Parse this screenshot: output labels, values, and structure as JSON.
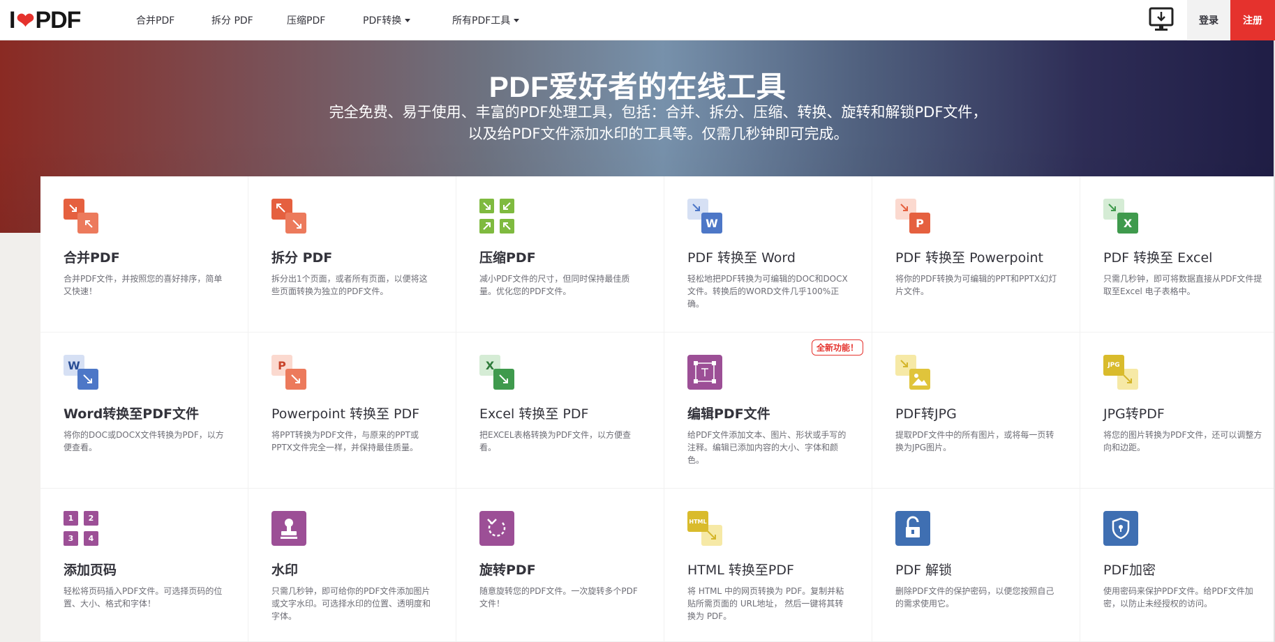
{
  "header": {
    "logo_left": "I",
    "logo_right": "PDF",
    "nav": [
      {
        "label": "合并PDF",
        "dropdown": false
      },
      {
        "label": "拆分 PDF",
        "dropdown": false
      },
      {
        "label": "压缩PDF",
        "dropdown": false
      },
      {
        "label": "PDF转换",
        "dropdown": true
      },
      {
        "label": "所有PDF工具",
        "dropdown": true
      }
    ],
    "login": "登录",
    "signup": "注册"
  },
  "hero": {
    "title": "PDF爱好者的在线工具",
    "subtitle": "完全免费、易于使用、丰富的PDF处理工具，包括：合并、拆分、压缩、转换、旋转和解锁PDF文件，以及给PDF文件添加水印的工具等。仅需几秒钟即可完成。"
  },
  "tools": [
    {
      "title": "合并PDF",
      "desc": "合并PDF文件，并按照您的喜好排序，简单又快速！",
      "icon": "merge-icon"
    },
    {
      "title": "拆分 PDF",
      "desc": "拆分出1个页面，或者所有页面，以便将这些页面转换为独立的PDF文件。",
      "icon": "split-icon"
    },
    {
      "title": "压缩PDF",
      "desc": "减小PDF文件的尺寸，但同时保持最佳质量。优化您的PDF文件。",
      "icon": "compress-icon"
    },
    {
      "title": "PDF 转换至 Word",
      "desc": "轻松地把PDF转换为可编辑的DOC和DOCX文件。转换后的WORD文件几乎100%正确。",
      "icon": "pdf-to-word-icon"
    },
    {
      "title": "PDF 转换至 Powerpoint",
      "desc": "将你的PDF转换为可编辑的PPT和PPTX幻灯片文件。",
      "icon": "pdf-to-powerpoint-icon"
    },
    {
      "title": "PDF 转换至 Excel",
      "desc": "只需几秒钟，即可将数据直接从PDF文件提取至Excel 电子表格中。",
      "icon": "pdf-to-excel-icon"
    },
    {
      "title": "Word转换至PDF文件",
      "desc": "将你的DOC或DOCX文件转换为PDF，以方便查看。",
      "icon": "word-to-pdf-icon"
    },
    {
      "title": "Powerpoint 转换至 PDF",
      "desc": "将PPT转换为PDF文件，与原来的PPT或PPTX文件完全一样，并保持最佳质量。",
      "icon": "powerpoint-to-pdf-icon"
    },
    {
      "title": "Excel 转换至 PDF",
      "desc": "把EXCEL表格转换为PDF文件，以方便查看。",
      "icon": "excel-to-pdf-icon"
    },
    {
      "title": "编辑PDF文件",
      "desc": "给PDF文件添加文本、图片、形状或手写的注释。编辑已添加内容的大小、字体和颜色。",
      "icon": "edit-pdf-icon",
      "badge": "全新功能！"
    },
    {
      "title": "PDF转JPG",
      "desc": "提取PDF文件中的所有图片，或将每一页转换为JPG图片。",
      "icon": "pdf-to-jpg-icon"
    },
    {
      "title": "JPG转PDF",
      "desc": "将您的图片转换为PDF文件，还可以调整方向和边距。",
      "icon": "jpg-to-pdf-icon"
    },
    {
      "title": "添加页码",
      "desc": "轻松将页码插入PDF文件。可选择页码的位置、大小、格式和字体！",
      "icon": "page-numbers-icon"
    },
    {
      "title": "水印",
      "desc": "只需几秒钟，即可给你的PDF文件添加图片或文字水印。可选择水印的位置、透明度和字体。",
      "icon": "watermark-icon"
    },
    {
      "title": "旋转PDF",
      "desc": "随意旋转您的PDF文件。一次旋转多个PDF文件！",
      "icon": "rotate-icon"
    },
    {
      "title": "HTML 转换至PDF",
      "desc": "将 HTML 中的网页转换为 PDF。复制并粘贴所需页面的 URL地址， 然后一键将其转换为 PDF。",
      "icon": "html-to-pdf-icon"
    },
    {
      "title": "PDF 解锁",
      "desc": "删除PDF文件的保护密码，以便您按照自己的需求使用它。",
      "icon": "unlock-icon"
    },
    {
      "title": "PDF加密",
      "desc": "使用密码来保护PDF文件。给PDF文件加密，以防止未经授权的访问。",
      "icon": "protect-icon"
    }
  ],
  "icon_glyphs": {
    "word": "W",
    "powerpoint": "P",
    "excel": "X",
    "jpg": "JPG",
    "html": "HTML",
    "page_numbers": [
      "1",
      "2",
      "3",
      "4"
    ]
  },
  "colors": {
    "brand_red": "#e5322d",
    "orange": "#e5603f",
    "green": "#7fba3f",
    "word_blue": "#4d77c7",
    "ppt_orange": "#e5603f",
    "excel_green": "#3f9a4d",
    "purple": "#9c4f96",
    "yellow": "#e0c43b",
    "lock_blue": "#3f6fb2"
  }
}
